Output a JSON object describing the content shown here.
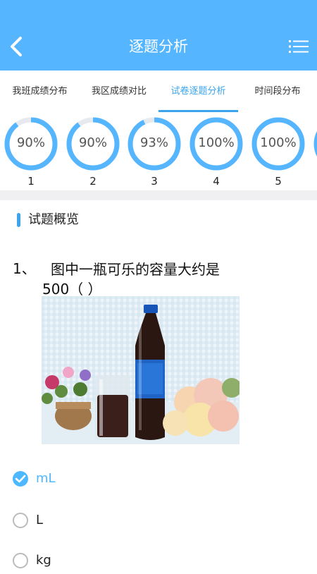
{
  "header": {
    "title": "逐题分析",
    "back_icon": "chevron-left-icon",
    "menu_icon": "list-icon",
    "bg_color": "#55b5ff"
  },
  "tabs": [
    {
      "label": "我班成绩分布",
      "active": false
    },
    {
      "label": "我区成绩对比",
      "active": false
    },
    {
      "label": "试卷逐题分析",
      "active": true
    },
    {
      "label": "时间段分布",
      "active": false
    }
  ],
  "questions_summary": [
    {
      "number": "1",
      "percent_label": "90%",
      "percent": 90
    },
    {
      "number": "2",
      "percent_label": "90%",
      "percent": 90
    },
    {
      "number": "3",
      "percent_label": "93%",
      "percent": 93
    },
    {
      "number": "4",
      "percent_label": "100%",
      "percent": 100
    },
    {
      "number": "5",
      "percent_label": "100%",
      "percent": 100
    }
  ],
  "section": {
    "title": "试题概览"
  },
  "question": {
    "number": "1、",
    "line1": "图中一瓶可乐的容量大约是",
    "line2": "500（   ）",
    "image_icon": "cola-bottle-photo"
  },
  "options": [
    {
      "label": "mL",
      "selected": true
    },
    {
      "label": "L",
      "selected": false
    },
    {
      "label": "kg",
      "selected": false
    }
  ],
  "colors": {
    "accent": "#3aa5ee",
    "ring": "#55b5ff",
    "ring_track": "#e6e9ee"
  }
}
